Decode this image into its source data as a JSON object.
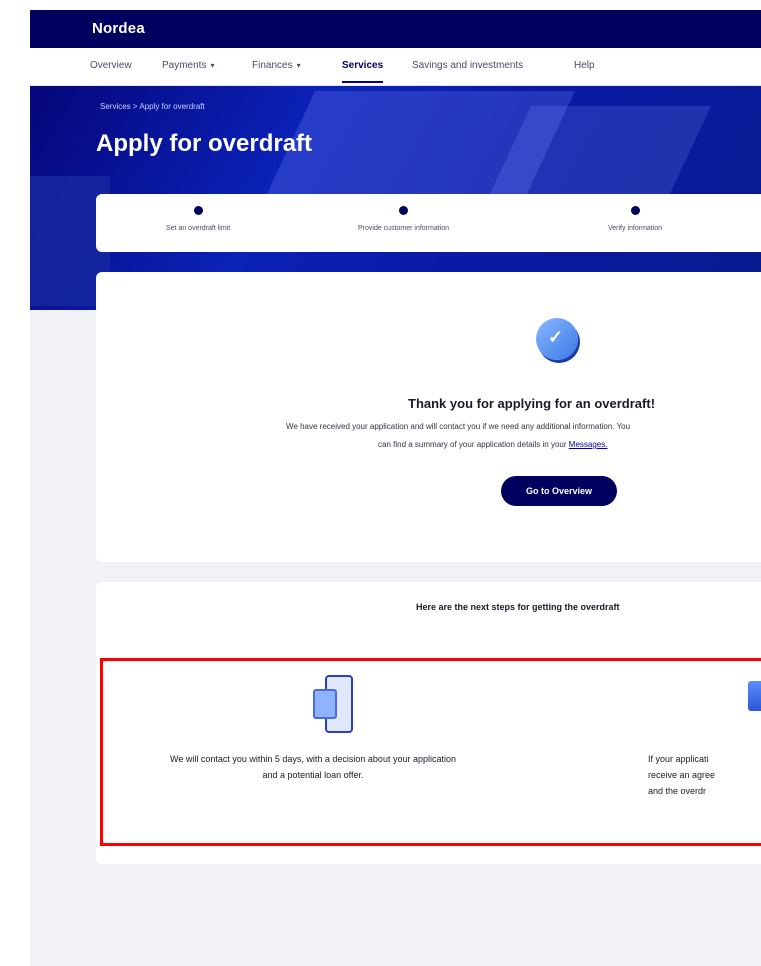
{
  "header": {
    "brand": "Nordea"
  },
  "nav": {
    "items": [
      {
        "label": "Overview"
      },
      {
        "label": "Payments"
      },
      {
        "label": "Finances"
      },
      {
        "label": "Services"
      },
      {
        "label": "Savings and investments"
      },
      {
        "label": "Help"
      }
    ],
    "active": "Services"
  },
  "hero": {
    "breadcrumb": "Services  >  Apply for overdraft",
    "title": "Apply for overdraft"
  },
  "stepper": {
    "steps": [
      {
        "label": "Set an overdraft limit"
      },
      {
        "label": "Provide customer information"
      },
      {
        "label": "Verify information"
      }
    ]
  },
  "confirmation": {
    "title": "Thank you for applying for an overdraft!",
    "body_line1": "We have received your application and will contact you if we need any additional information. You",
    "body_line2_prefix": "can find a summary of your application details in your",
    "body_link": "Messages.",
    "button": "Go to Overview"
  },
  "next_steps": {
    "title": "Here are the next steps for getting the overdraft",
    "items": [
      {
        "icon": "phone-icon",
        "text": "We will contact you within 5 days, with a decision about your application and a potential loan offer."
      },
      {
        "icon": "tray-icon",
        "text": "If your application is approved, you will receive an agreement to sign and the overdraft limit becomes available."
      }
    ],
    "item2_lines": [
      "If your applicati",
      "receive an agree",
      "and the overdr"
    ]
  },
  "colors": {
    "brand_navy": "#00005e",
    "accent_blue": "#0000a0",
    "highlight_red": "#ff0000",
    "page_bg": "#f0f2f5"
  }
}
